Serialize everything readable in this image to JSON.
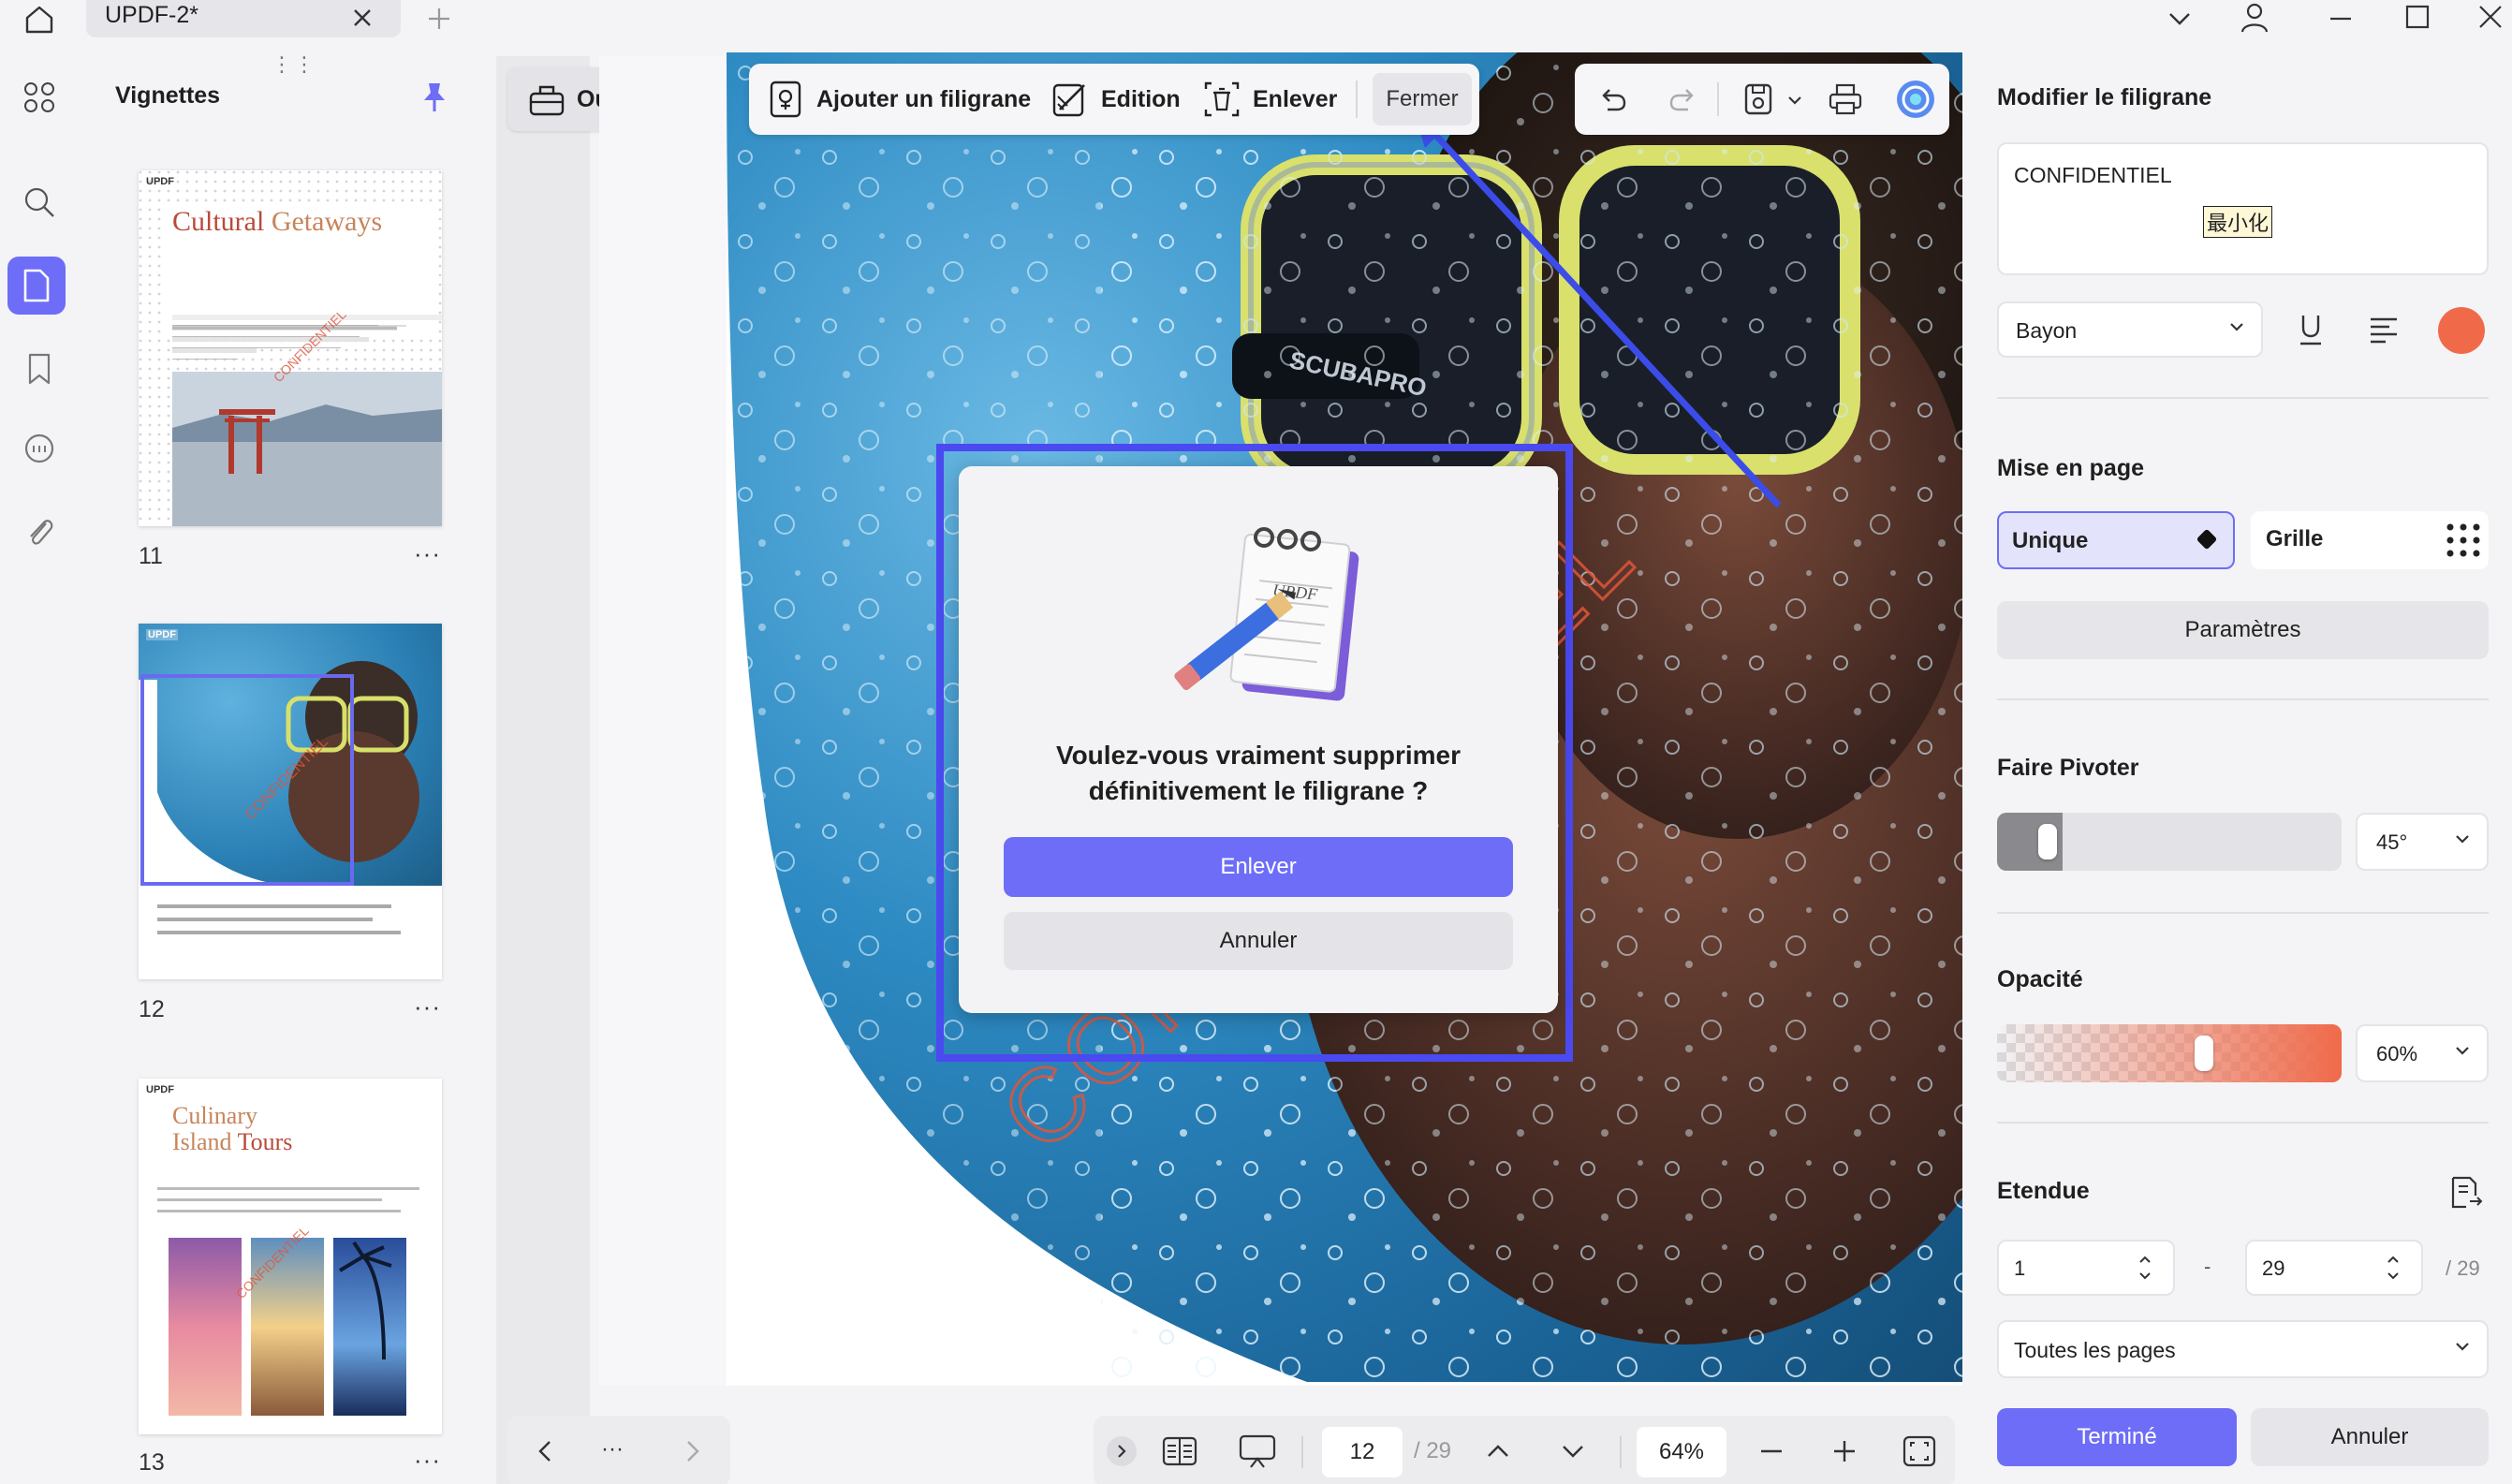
{
  "titlebar": {
    "tab_title": "UPDF-2*"
  },
  "thumbnails": {
    "title": "Vignettes",
    "pages": [
      {
        "number": "11",
        "heading_a": "Cultural",
        "heading_b": "Getaways"
      },
      {
        "number": "12"
      },
      {
        "number": "13",
        "heading_a": "Culinary",
        "heading_b": "Island",
        "heading_c": "Tours"
      }
    ],
    "logo_text": "UPDF",
    "more": "···"
  },
  "tools": {
    "outils_label": "Outils"
  },
  "watermark_toolbar": {
    "add_label": "Ajouter un filigrane",
    "edit_label": "Edition",
    "remove_label": "Enlever",
    "close_label": "Fermer"
  },
  "page": {
    "watermark_text": "CONFIDENTIEL"
  },
  "dialog": {
    "message": "Voulez-vous vraiment supprimer définitivement le filigrane ?",
    "remove_label": "Enlever",
    "cancel_label": "Annuler",
    "notepad_text": "UPDF"
  },
  "bottom_nav": {
    "ellipsis": "···",
    "page_current": "12",
    "page_total": "/ 29",
    "zoom": "64%"
  },
  "right_panel": {
    "title": "Modifier le filigrane",
    "text_value": "CONFIDENTIEL",
    "ime_hint": "最小化",
    "font": "Bayon",
    "color": "#f06a4a",
    "layout_title": "Mise en page",
    "layout_unique": "Unique",
    "layout_grid": "Grille",
    "params_label": "Paramètres",
    "rotate_title": "Faire Pivoter",
    "rotate_value": "45°",
    "rotate_level": 0.05,
    "opacity_title": "Opacité",
    "opacity_value": "60%",
    "opacity_level": 0.6,
    "range_title": "Etendue",
    "range_from": "1",
    "range_dash": "-",
    "range_to": "29",
    "range_total": "/ 29",
    "range_scope": "Toutes les pages",
    "done_label": "Terminé",
    "cancel_label": "Annuler"
  },
  "colors": {
    "accent": "#6d6df7",
    "frame": "#4a4af0",
    "watermark": "#e0553a"
  }
}
